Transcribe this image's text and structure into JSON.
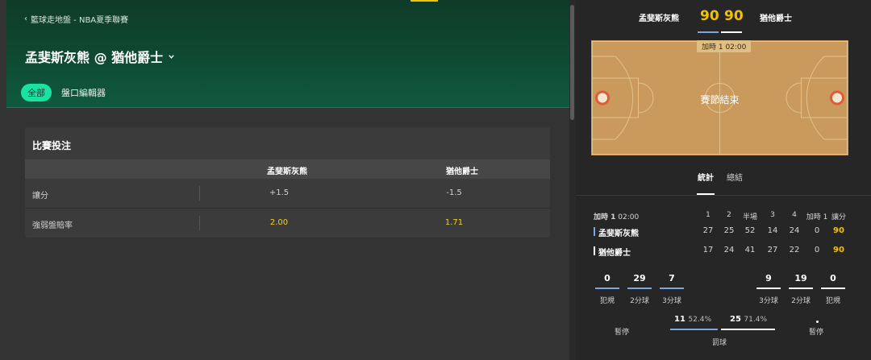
{
  "breadcrumb": {
    "back": "‹",
    "text": "籃球走地盤 - NBA夏季聯賽"
  },
  "match_title": "孟斐斯灰熊 @ 猶他爵士",
  "tabs": {
    "all": "全部",
    "editor": "盤口編輯器"
  },
  "card": {
    "title": "比賽投注",
    "headers": [
      "孟斐斯灰熊",
      "猶他爵士"
    ],
    "rows": [
      {
        "label": "讓分",
        "home": "+1.5",
        "away": "-1.5"
      },
      {
        "label": "強弱盤賠率",
        "home": "2.00",
        "away": "1.71"
      }
    ]
  },
  "scoreboard": {
    "home_name": "孟斐斯灰熊",
    "away_name": "猶他爵士",
    "home_score": "90",
    "away_score": "90",
    "period_badge": "加時 1  02:00",
    "status": "賽節結束"
  },
  "stat_tabs": {
    "stats": "統計",
    "summary": "總結"
  },
  "box": {
    "period": "加時 1",
    "clock": "02:00",
    "headers": [
      "1",
      "2",
      "半場",
      "3",
      "4",
      "加時 1",
      "讓分"
    ],
    "teams": [
      {
        "name": "孟斐斯灰熊",
        "scores": [
          "27",
          "25",
          "52",
          "14",
          "24",
          "0",
          "90"
        ]
      },
      {
        "name": "猶他爵士",
        "scores": [
          "17",
          "24",
          "41",
          "27",
          "22",
          "0",
          "90"
        ]
      }
    ]
  },
  "team_stats": {
    "home": [
      {
        "value": "0",
        "label": "犯規"
      },
      {
        "value": "29",
        "label": "2分球"
      },
      {
        "value": "7",
        "label": "3分球"
      }
    ],
    "away": [
      {
        "value": "9",
        "label": "3分球"
      },
      {
        "value": "19",
        "label": "2分球"
      },
      {
        "value": "0",
        "label": "犯規"
      }
    ],
    "timeout_label": "暫停",
    "free_throw": {
      "home_made": "11",
      "home_pct": "52.4%",
      "away_made": "25",
      "away_pct": "71.4%",
      "label": "罰球",
      "home_fraction": 0.524,
      "away_fraction": 0.714
    }
  },
  "colors": {
    "accent": "#19e3a0",
    "gold": "#f2c200",
    "home_line": "#7aa7e0",
    "away_line": "#ffffff"
  }
}
